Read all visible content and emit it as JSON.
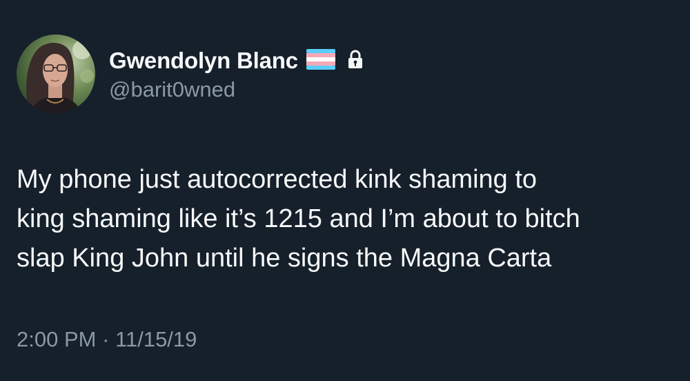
{
  "user": {
    "display_name": "Gwendolyn Blanc",
    "handle": "@barit0wned",
    "badge_icon": "transgender-flag-icon",
    "protected_icon": "lock-icon"
  },
  "tweet": {
    "text": "My phone just autocorrected kink shaming to\nking shaming like it’s 1215 and I’m about to bitch\nslap King John until he signs the Magna Carta",
    "time": "2:00 PM",
    "separator": "·",
    "date": "11/15/19"
  },
  "colors": {
    "background": "#15202b",
    "primary_text": "#f7f9f9",
    "secondary_text": "#8b98a5",
    "flag_blue": "#5bcefa",
    "flag_pink": "#f5a9b8",
    "flag_white": "#ffffff"
  }
}
